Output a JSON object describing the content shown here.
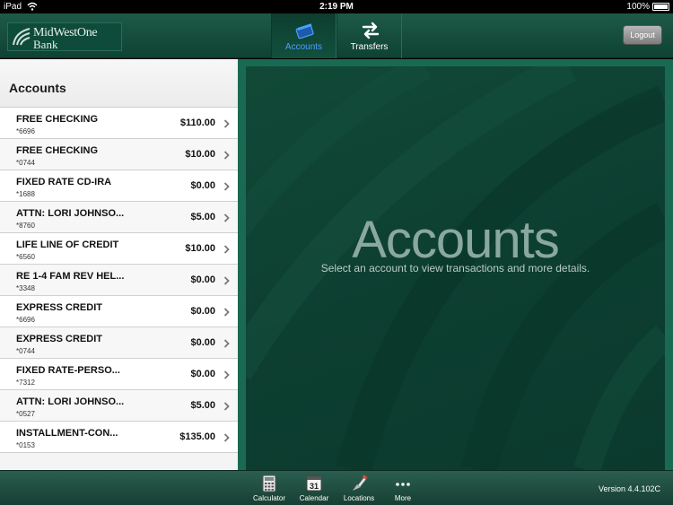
{
  "status_bar": {
    "carrier": "iPad",
    "time": "2:19 PM",
    "battery": "100%"
  },
  "header": {
    "logo_line1": "MidWestOne",
    "logo_line2": "Bank",
    "tabs": [
      {
        "label": "Accounts",
        "icon": "accounts-icon",
        "active": true
      },
      {
        "label": "Transfers",
        "icon": "transfers-icon",
        "active": false
      }
    ],
    "logout_label": "Logout"
  },
  "sidebar": {
    "title": "Accounts",
    "accounts": [
      {
        "name": "FREE CHECKING",
        "number": "*6696",
        "balance": "$110.00"
      },
      {
        "name": "FREE CHECKING",
        "number": "*0744",
        "balance": "$10.00"
      },
      {
        "name": "FIXED RATE CD-IRA",
        "number": "*1688",
        "balance": "$0.00"
      },
      {
        "name": "ATTN: LORI JOHNSO...",
        "number": "*8760",
        "balance": "$5.00"
      },
      {
        "name": "LIFE LINE OF CREDIT",
        "number": "*6560",
        "balance": "$10.00"
      },
      {
        "name": "RE 1-4 FAM REV HEL...",
        "number": "*3348",
        "balance": "$0.00"
      },
      {
        "name": "EXPRESS CREDIT",
        "number": "*6696",
        "balance": "$0.00"
      },
      {
        "name": "EXPRESS CREDIT",
        "number": "*0744",
        "balance": "$0.00"
      },
      {
        "name": "FIXED RATE-PERSO...",
        "number": "*7312",
        "balance": "$0.00"
      },
      {
        "name": "ATTN: LORI JOHNSO...",
        "number": "*0527",
        "balance": "$5.00"
      },
      {
        "name": "INSTALLMENT-CON...",
        "number": "*0153",
        "balance": "$135.00"
      }
    ]
  },
  "main": {
    "title": "Accounts",
    "subtitle": "Select an account to view transactions and more details."
  },
  "bottom_bar": {
    "items": [
      {
        "label": "Calculator",
        "icon": "calculator-icon"
      },
      {
        "label": "Calendar",
        "icon": "calendar-icon",
        "day": "31"
      },
      {
        "label": "Locations",
        "icon": "locations-icon"
      },
      {
        "label": "More",
        "icon": "more-icon"
      }
    ],
    "version": "Version 4.4.102C"
  },
  "colors": {
    "brand_green": "#114937",
    "active_tab": "#4aa0ff"
  }
}
